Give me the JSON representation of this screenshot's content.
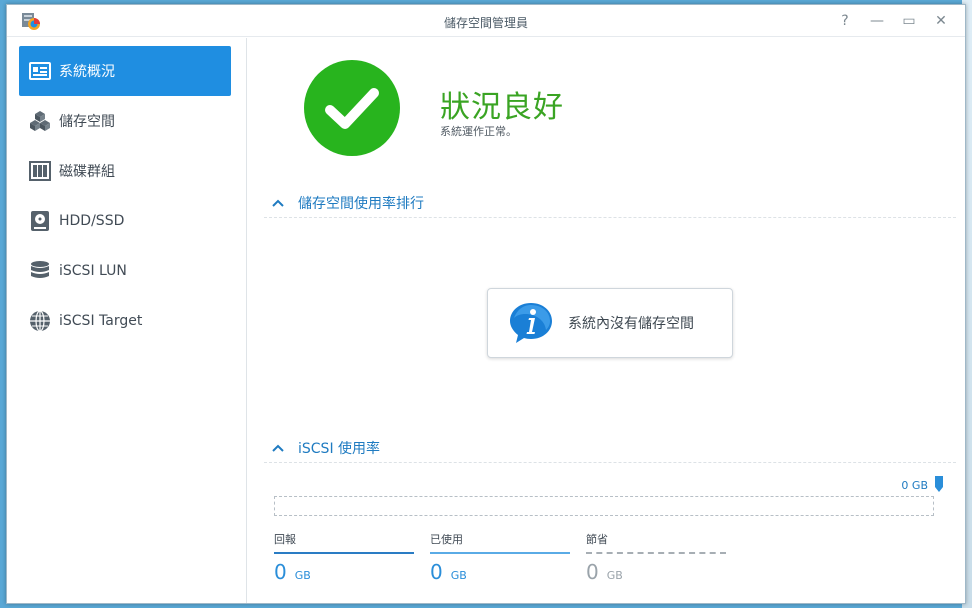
{
  "window": {
    "title": "儲存空間管理員",
    "buttons": {
      "help": "?",
      "minimize": "—",
      "maximize": "▭",
      "close": "✕"
    }
  },
  "sidebar": {
    "items": [
      {
        "label": "系統概況",
        "icon": "overview-icon",
        "active": true
      },
      {
        "label": "儲存空間",
        "icon": "cubes-icon",
        "active": false
      },
      {
        "label": "磁碟群組",
        "icon": "disk-group-icon",
        "active": false
      },
      {
        "label": "HDD/SSD",
        "icon": "hdd-icon",
        "active": false
      },
      {
        "label": "iSCSI LUN",
        "icon": "database-icon",
        "active": false
      },
      {
        "label": "iSCSI Target",
        "icon": "globe-icon",
        "active": false
      }
    ]
  },
  "status": {
    "title": "狀況良好",
    "subtitle": "系統運作正常。"
  },
  "sections": {
    "volume_usage": {
      "title": "儲存空間使用率排行",
      "empty_message": "系統內沒有儲存空間"
    },
    "iscsi_usage": {
      "title": "iSCSI 使用率",
      "quota_label": "0 GB",
      "stats": [
        {
          "label": "回報",
          "value": "0",
          "unit": "GB"
        },
        {
          "label": "已使用",
          "value": "0",
          "unit": "GB"
        },
        {
          "label": "節省",
          "value": "0",
          "unit": "GB"
        }
      ]
    }
  },
  "colors": {
    "accent": "#1f8ee1",
    "ok_green": "#28b41e",
    "link_blue": "#1f7bc1"
  }
}
